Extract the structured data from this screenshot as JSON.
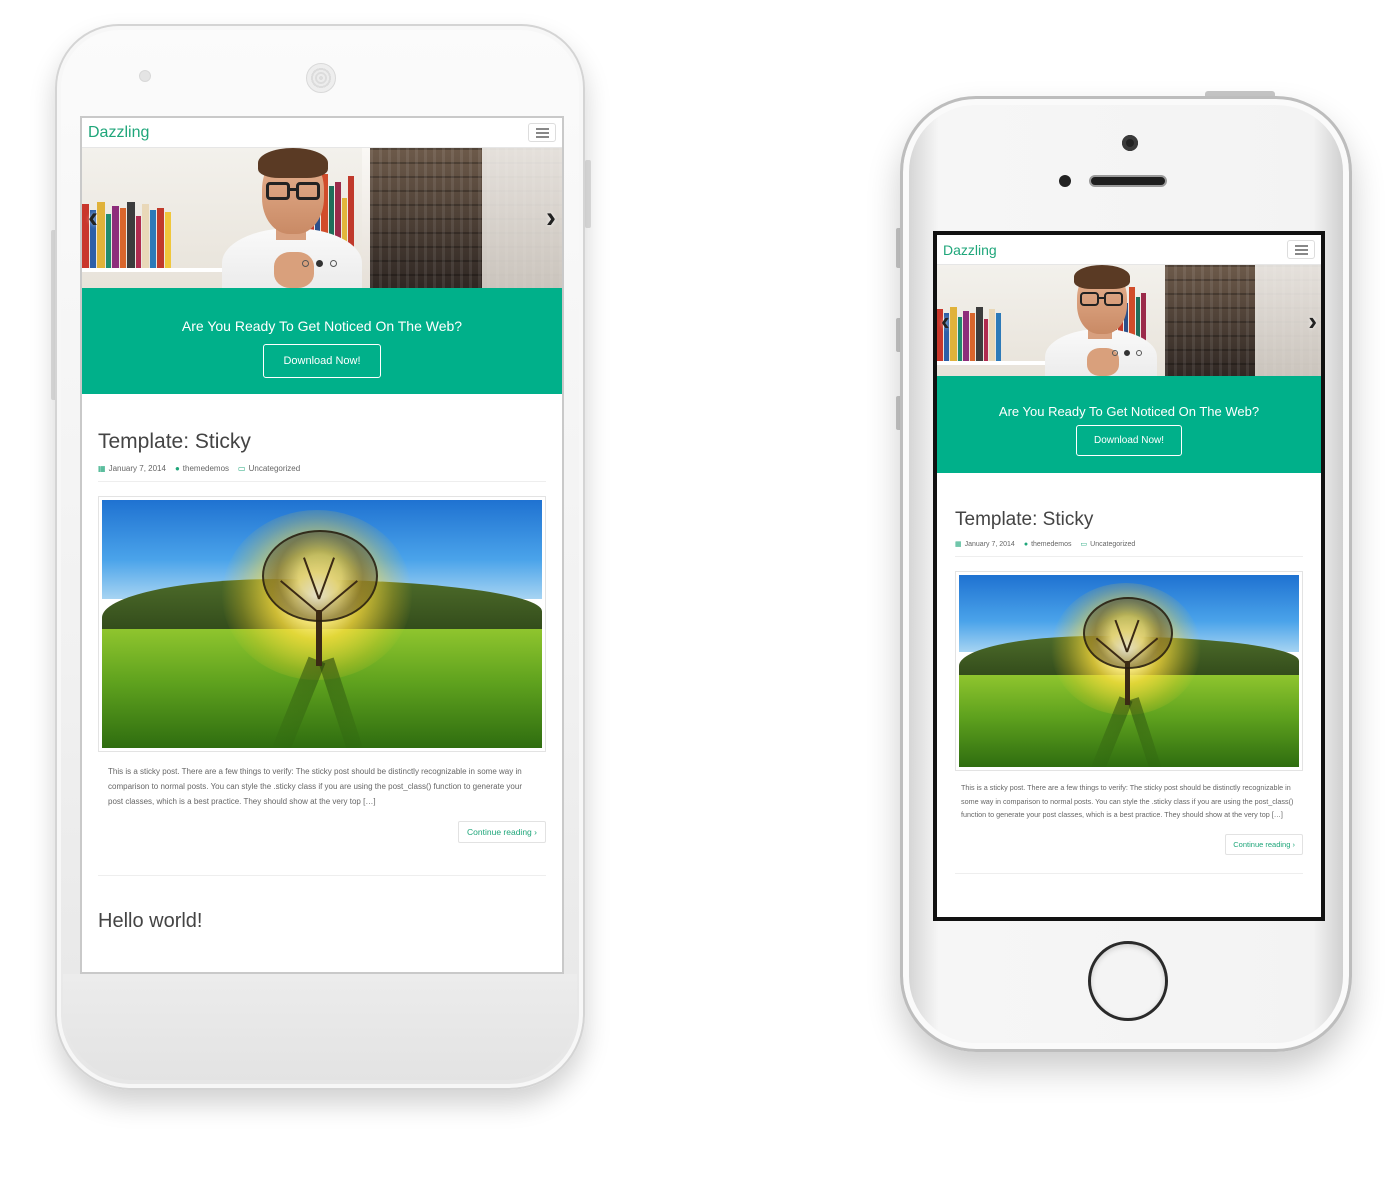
{
  "site": {
    "brand": "Dazzling",
    "menu_icon": "hamburger-menu-icon"
  },
  "slider": {
    "prev_icon": "chevron-left-icon",
    "next_icon": "chevron-right-icon",
    "prev_glyph": "‹",
    "next_glyph": "›",
    "slide_count": 3,
    "active_slide": 2
  },
  "cta": {
    "heading": "Are You Ready To Get Noticed On The Web?",
    "button_label": "Download Now!"
  },
  "posts": [
    {
      "title": "Template: Sticky",
      "date": "January 7, 2014",
      "author": "themedemos",
      "category": "Uncategorized",
      "excerpt": "This is a sticky post. There are a few things to verify: The sticky post should be distinctly recognizable in some way in comparison to normal posts. You can style the .sticky class if you are using the post_class() function to generate your post classes, which is a best practice. They should show at the very top […]",
      "more_label": "Continue reading",
      "more_icon": "chevron-right-icon",
      "more_glyph": "›"
    },
    {
      "title": "Hello world!"
    }
  ],
  "icons": {
    "date": "calendar-icon",
    "author": "user-icon",
    "category": "folder-open-icon"
  },
  "colors": {
    "accent": "#1fa67a",
    "cta_bg": "#00b08a"
  }
}
